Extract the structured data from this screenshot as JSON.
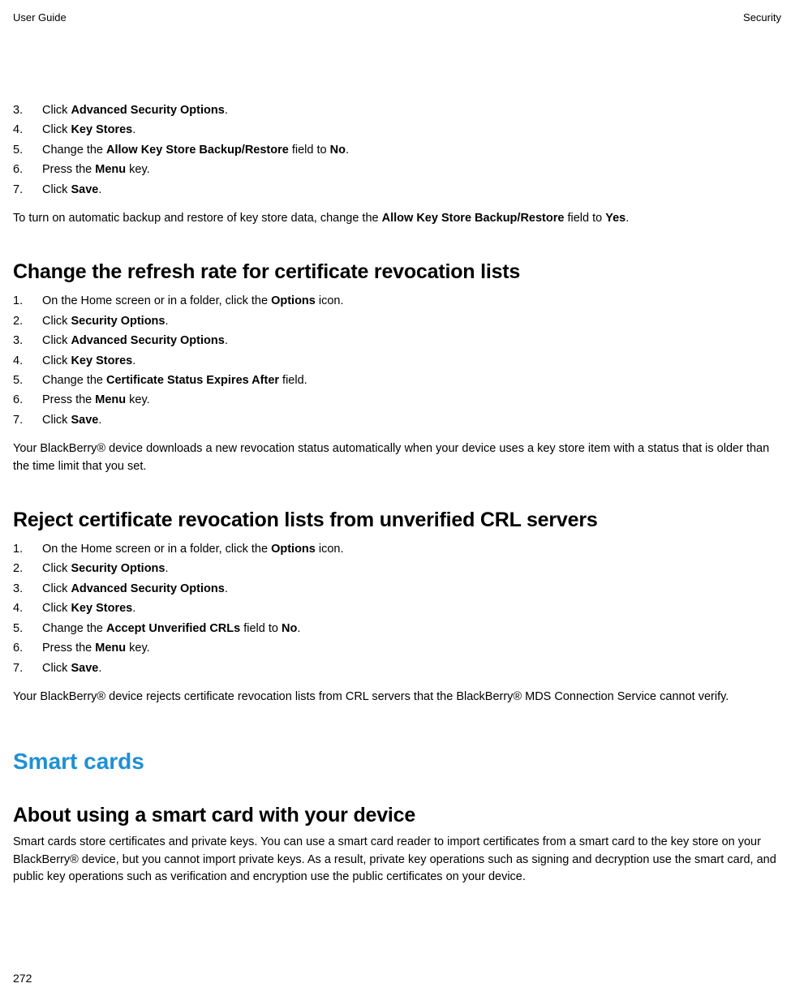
{
  "header": {
    "left": "User Guide",
    "right": "Security"
  },
  "top_steps": [
    {
      "num": "3.",
      "pre": "Click ",
      "bold": "Advanced Security Options",
      "post": "."
    },
    {
      "num": "4.",
      "pre": "Click ",
      "bold": "Key Stores",
      "post": "."
    },
    {
      "num": "5.",
      "pre": "Change the ",
      "bold": "Allow Key Store Backup/Restore",
      "post": " field to ",
      "bold2": "No",
      "post2": "."
    },
    {
      "num": "6.",
      "pre": "Press the ",
      "bold": "Menu",
      "post": " key."
    },
    {
      "num": "7.",
      "pre": "Click ",
      "bold": "Save",
      "post": "."
    }
  ],
  "top_note_pre": "To turn on automatic backup and restore of key store data, change the ",
  "top_note_bold1": "Allow Key Store Backup/Restore",
  "top_note_mid": " field to ",
  "top_note_bold2": "Yes",
  "top_note_post": ".",
  "section1": {
    "title": "Change the refresh rate for certificate revocation lists",
    "steps": [
      {
        "num": "1.",
        "pre": "On the Home screen or in a folder, click the ",
        "bold": "Options",
        "post": " icon."
      },
      {
        "num": "2.",
        "pre": "Click ",
        "bold": "Security Options",
        "post": "."
      },
      {
        "num": "3.",
        "pre": "Click ",
        "bold": "Advanced Security Options",
        "post": "."
      },
      {
        "num": "4.",
        "pre": "Click ",
        "bold": "Key Stores",
        "post": "."
      },
      {
        "num": "5.",
        "pre": "Change the ",
        "bold": "Certificate Status Expires After",
        "post": " field."
      },
      {
        "num": "6.",
        "pre": "Press the ",
        "bold": "Menu",
        "post": " key."
      },
      {
        "num": "7.",
        "pre": "Click ",
        "bold": "Save",
        "post": "."
      }
    ],
    "note": "Your BlackBerry® device downloads a new revocation status automatically when your device uses a key store item with a status that is older than the time limit that you set."
  },
  "section2": {
    "title": "Reject certificate revocation lists from unverified CRL servers",
    "steps": [
      {
        "num": "1.",
        "pre": "On the Home screen or in a folder, click the ",
        "bold": "Options",
        "post": " icon."
      },
      {
        "num": "2.",
        "pre": "Click ",
        "bold": "Security Options",
        "post": "."
      },
      {
        "num": "3.",
        "pre": "Click ",
        "bold": "Advanced Security Options",
        "post": "."
      },
      {
        "num": "4.",
        "pre": "Click ",
        "bold": "Key Stores",
        "post": "."
      },
      {
        "num": "5.",
        "pre": "Change the ",
        "bold": "Accept Unverified CRLs",
        "post": " field to ",
        "bold2": "No",
        "post2": "."
      },
      {
        "num": "6.",
        "pre": "Press the ",
        "bold": "Menu",
        "post": " key."
      },
      {
        "num": "7.",
        "pre": "Click ",
        "bold": "Save",
        "post": "."
      }
    ],
    "note": "Your BlackBerry® device rejects certificate revocation lists from CRL servers that the BlackBerry® MDS Connection Service cannot verify."
  },
  "smart_cards_title": "Smart cards",
  "about_title": "About using a smart card with your device",
  "about_text": "Smart cards store certificates and private keys. You can use a smart card reader to import certificates from a smart card to the key store on your BlackBerry® device, but you cannot import private keys. As a result, private key operations such as signing and decryption use the smart card, and public key operations such as verification and encryption use the public certificates on your device.",
  "page_number": "272"
}
